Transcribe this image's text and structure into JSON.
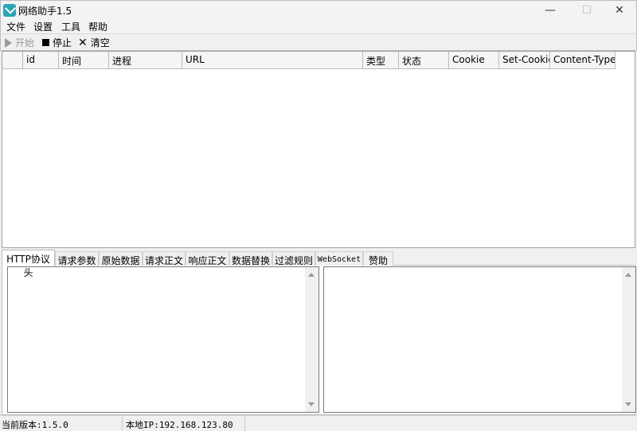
{
  "window": {
    "title": "网络助手1.5",
    "controls": {
      "minimize": "—",
      "maximize": "☐",
      "close": "✕"
    }
  },
  "menu": [
    "文件",
    "设置",
    "工具",
    "帮助"
  ],
  "toolbar": {
    "start_label": "开始",
    "stop_label": "停止",
    "clear_label": "清空"
  },
  "table": {
    "columns": [
      "",
      "id",
      "时间",
      "进程",
      "URL",
      "类型",
      "状态",
      "Cookie",
      "Set-Cookie",
      "Content-Type"
    ],
    "rows": []
  },
  "tabs": [
    "HTTP协议头",
    "请求参数",
    "原始数据",
    "请求正文",
    "响应正文",
    "数据替换",
    "过滤规则",
    "WebSocket",
    "赞助"
  ],
  "status": {
    "version": "当前版本:1.5.0",
    "local_ip": "本地IP:192.168.123.80"
  },
  "icons": {
    "app": "app-check-icon",
    "start": "play-icon",
    "stop": "stop-square-icon",
    "clear": "x-icon"
  },
  "colors": {
    "app_icon": "#2aa4b5"
  }
}
